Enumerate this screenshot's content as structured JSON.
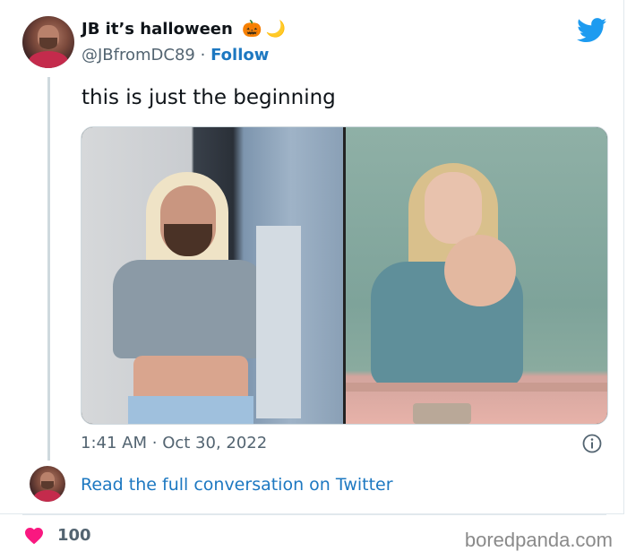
{
  "tweet": {
    "display_name": "JB it’s halloween",
    "name_emojis": [
      "🎃",
      "🌙"
    ],
    "handle": "@JBfromDC89",
    "separator": "·",
    "follow_label": "Follow",
    "text": "this is just the beginning",
    "time": "1:41 AM",
    "date": "Oct 30, 2022",
    "read_more": "Read the full conversation on Twitter",
    "likes": "100"
  },
  "icons": {
    "platform": "twitter-bird-icon",
    "info": "info-icon",
    "like": "heart-icon"
  },
  "colors": {
    "link": "#1d78c1",
    "twitter_blue": "#1d9bf0",
    "heart": "#f91880",
    "muted": "#536471"
  },
  "watermark": "boredpanda.com"
}
